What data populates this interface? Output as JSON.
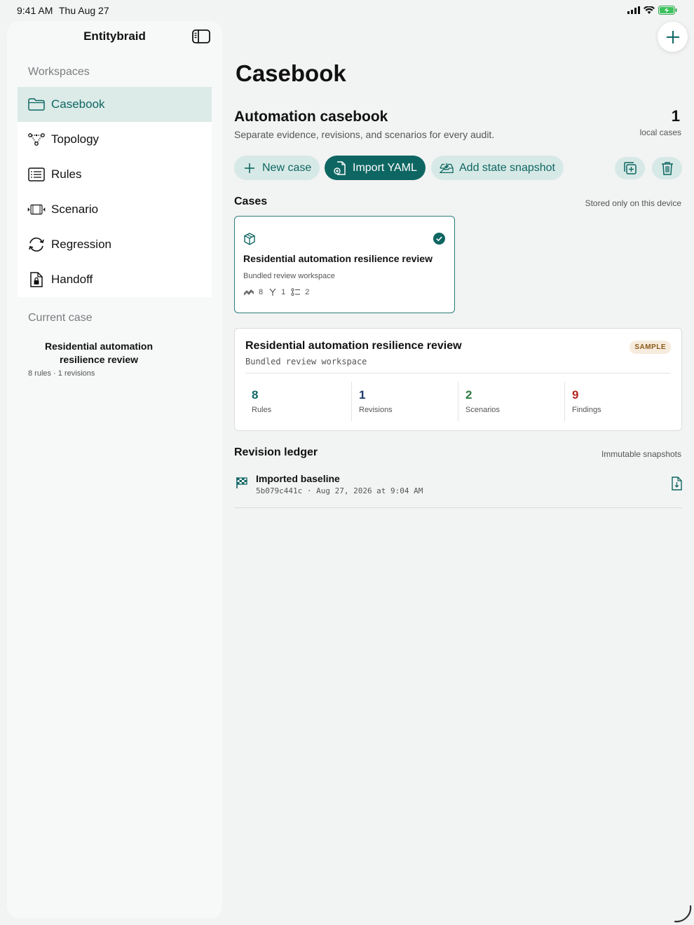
{
  "status_bar": {
    "time": "9:41 AM",
    "date": "Thu Aug 27"
  },
  "sidebar": {
    "app_title": "Entitybraid",
    "workspaces_label": "Workspaces",
    "items": [
      {
        "label": "Casebook",
        "icon": "folder-icon",
        "active": true
      },
      {
        "label": "Topology",
        "icon": "topology-icon",
        "active": false
      },
      {
        "label": "Rules",
        "icon": "list-icon",
        "active": false
      },
      {
        "label": "Scenario",
        "icon": "film-icon",
        "active": false
      },
      {
        "label": "Regression",
        "icon": "cycle-icon",
        "active": false
      },
      {
        "label": "Handoff",
        "icon": "lock-document-icon",
        "active": false
      }
    ],
    "current_case_label": "Current case",
    "current_case_title": "Residential automation resilience review",
    "current_case_meta": "8 rules · 1 revisions"
  },
  "main": {
    "page_title": "Casebook",
    "section_title": "Automation casebook",
    "section_subtitle": "Separate evidence, revisions, and scenarios for every audit.",
    "local_count": "1",
    "local_count_label": "local cases",
    "actions": {
      "new_case": "New case",
      "import_yaml": "Import YAML",
      "add_snapshot": "Add state snapshot"
    },
    "cases_heading": "Cases",
    "cases_note": "Stored only on this device",
    "case_card": {
      "title": "Residential automation resilience review",
      "subtitle": "Bundled review workspace",
      "rules": "8",
      "revisions": "1",
      "scenarios": "2"
    },
    "detail": {
      "title": "Residential automation resilience review",
      "subtitle": "Bundled review workspace",
      "badge": "SAMPLE",
      "metrics": [
        {
          "value": "8",
          "label": "Rules",
          "color": "#0e6662"
        },
        {
          "value": "1",
          "label": "Revisions",
          "color": "#1d3b6b"
        },
        {
          "value": "2",
          "label": "Scenarios",
          "color": "#2c7a3f"
        },
        {
          "value": "9",
          "label": "Findings",
          "color": "#b3261e"
        }
      ]
    },
    "ledger_heading": "Revision ledger",
    "ledger_note": "Immutable snapshots",
    "revision": {
      "title": "Imported baseline",
      "meta": "5b079c441c · Aug 27, 2026 at 9:04 AM"
    }
  },
  "colors": {
    "accent": "#0e6662",
    "accent_light": "#d7e9e6",
    "sidebar_active": "#dcebe8"
  }
}
